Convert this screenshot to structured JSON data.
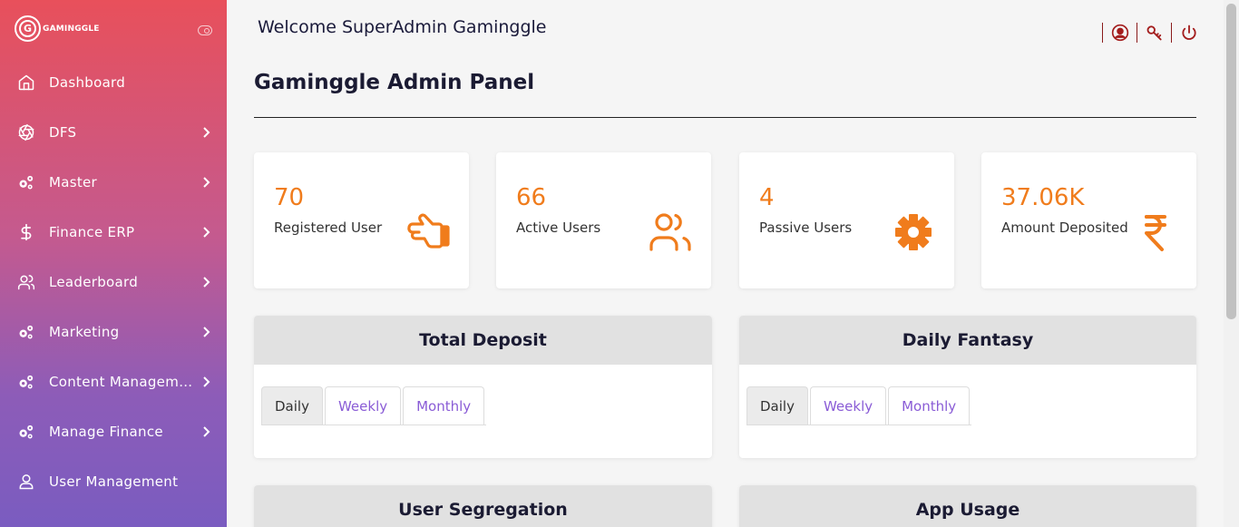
{
  "sidebar": {
    "logo_letter": "G",
    "logo_text": "GAMINGGLE",
    "items": [
      {
        "label": "Dashboard",
        "icon": "home-icon"
      },
      {
        "label": "DFS",
        "icon": "aperture-icon"
      },
      {
        "label": "Master",
        "icon": "gears-icon"
      },
      {
        "label": "Finance ERP",
        "icon": "dollar-icon"
      },
      {
        "label": "Leaderboard",
        "icon": "users-icon"
      },
      {
        "label": "Marketing",
        "icon": "gears-icon"
      },
      {
        "label": "Content Manageme...",
        "icon": "gears-icon"
      },
      {
        "label": "Manage Finance",
        "icon": "gears-icon"
      },
      {
        "label": "User Management",
        "icon": "user-icon"
      }
    ]
  },
  "header": {
    "welcome": "Welcome SuperAdmin Gaminggle"
  },
  "main": {
    "title": "Gaminggle Admin Panel",
    "stats": [
      {
        "value": "70",
        "label": "Registered User",
        "icon": "hand-pointer-icon"
      },
      {
        "value": "66",
        "label": "Active Users",
        "icon": "users-icon"
      },
      {
        "value": "4",
        "label": "Passive Users",
        "icon": "cog-icon"
      },
      {
        "value": "37.06K",
        "label": "Amount Deposited",
        "icon": "rupee-icon"
      }
    ],
    "panels": [
      {
        "title": "Total Deposit",
        "tabs": [
          "Daily",
          "Weekly",
          "Monthly"
        ],
        "active": "Daily"
      },
      {
        "title": "Daily Fantasy",
        "tabs": [
          "Daily",
          "Weekly",
          "Monthly"
        ],
        "active": "Daily"
      },
      {
        "title": "User Segregation"
      },
      {
        "title": "App Usage"
      }
    ]
  },
  "colors": {
    "accent": "#f07c1c",
    "tab_text": "#8a5cd6",
    "sidebar_top": "#e8505b",
    "sidebar_bottom": "#7a5cc0",
    "header_icons": "#a31d1d"
  }
}
